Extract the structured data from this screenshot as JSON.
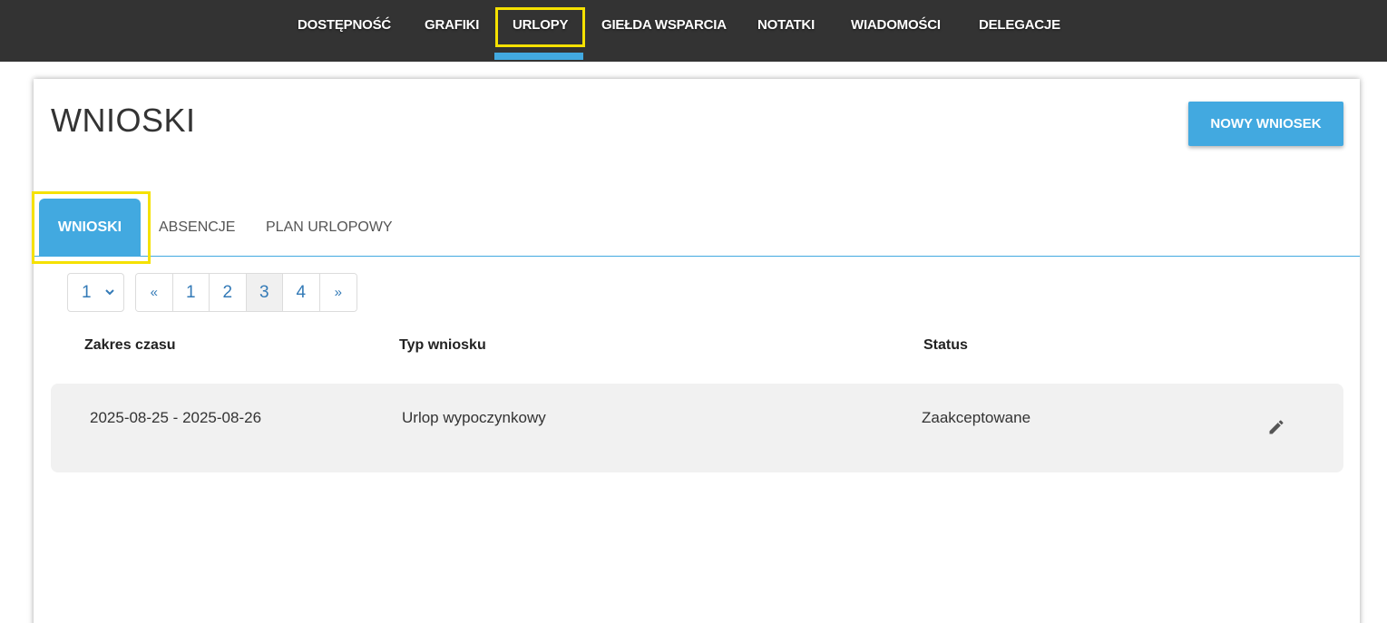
{
  "topnav": {
    "items": [
      {
        "label": "DOSTĘPNOŚĆ",
        "icon": null
      },
      {
        "label": "GRAFIKI"
      },
      {
        "label": "URLOPY",
        "active": true
      },
      {
        "label": "GIEŁDA WSPARCIA"
      },
      {
        "label": "NOTATKI"
      },
      {
        "label": "WIADOMOŚCI"
      },
      {
        "label": "DELEGACJE"
      }
    ]
  },
  "page": {
    "title": "WNIOSKI",
    "new_button": "NOWY WNIOSEK"
  },
  "tabs": [
    {
      "label": "WNIOSKI",
      "active": true
    },
    {
      "label": "ABSENCJE"
    },
    {
      "label": "PLAN URLOPOWY"
    }
  ],
  "pagination": {
    "per_page_value": "1",
    "prev": "«",
    "pages": [
      "1",
      "2",
      "3",
      "4"
    ],
    "current_page": "3",
    "next": "»"
  },
  "table": {
    "columns": [
      "Zakres czasu",
      "Typ wniosku",
      "Status"
    ],
    "rows": [
      {
        "range": "2025-08-25 - 2025-08-26",
        "type": "Urlop wypoczynkowy",
        "status": "Zaakceptowane",
        "action_icon": "pencil-icon"
      }
    ]
  },
  "colors": {
    "accent": "#42a9e0",
    "nav_bg": "#333333",
    "highlight": "#f5e100",
    "link": "#337ab7"
  }
}
